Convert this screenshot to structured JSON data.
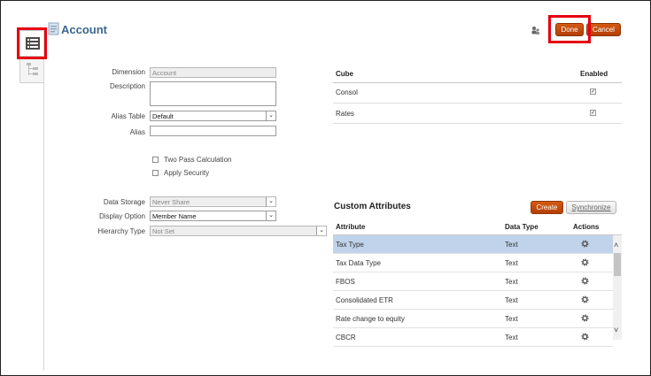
{
  "header": {
    "title": "Account"
  },
  "buttons": {
    "done": "Done",
    "cancel": "Cancel",
    "create": "Create",
    "synchronize": "Synchronize"
  },
  "form": {
    "dimension_label": "Dimension",
    "dimension_value": "Account",
    "description_label": "Description",
    "description_value": "",
    "alias_table_label": "Alias Table",
    "alias_table_value": "Default",
    "alias_label": "Alias",
    "alias_value": "",
    "two_pass_label": "Two Pass Calculation",
    "apply_security_label": "Apply Security",
    "data_storage_label": "Data Storage",
    "data_storage_value": "Never Share",
    "display_option_label": "Display Option",
    "display_option_value": "Member Name",
    "hierarchy_type_label": "Hierarchy Type",
    "hierarchy_type_value": "Not Set"
  },
  "cube_table": {
    "headers": {
      "cube": "Cube",
      "enabled": "Enabled"
    },
    "rows": [
      {
        "cube": "Consol",
        "enabled": true
      },
      {
        "cube": "Rates",
        "enabled": true
      }
    ]
  },
  "custom_attributes": {
    "title": "Custom Attributes",
    "headers": {
      "attribute": "Attribute",
      "data_type": "Data Type",
      "actions": "Actions"
    },
    "rows": [
      {
        "attribute": "Tax Type",
        "data_type": "Text",
        "selected": true
      },
      {
        "attribute": "Tax Data Type",
        "data_type": "Text"
      },
      {
        "attribute": "FBOS",
        "data_type": "Text"
      },
      {
        "attribute": "Consolidated ETR",
        "data_type": "Text"
      },
      {
        "attribute": "Rate change to equity",
        "data_type": "Text"
      },
      {
        "attribute": "CBCR",
        "data_type": "Text"
      }
    ]
  },
  "icons": {
    "tab_properties": "list-icon",
    "tab_hierarchy": "tree-icon",
    "title_icon": "dimension-icon",
    "users_icon": "users-icon",
    "action_icon": "gear-icon",
    "checkbox_checked": "✓"
  },
  "colors": {
    "accent": "#c4470b",
    "title": "#3a6791",
    "selected_row": "#c0d3ea",
    "highlight": "#e5000e"
  }
}
